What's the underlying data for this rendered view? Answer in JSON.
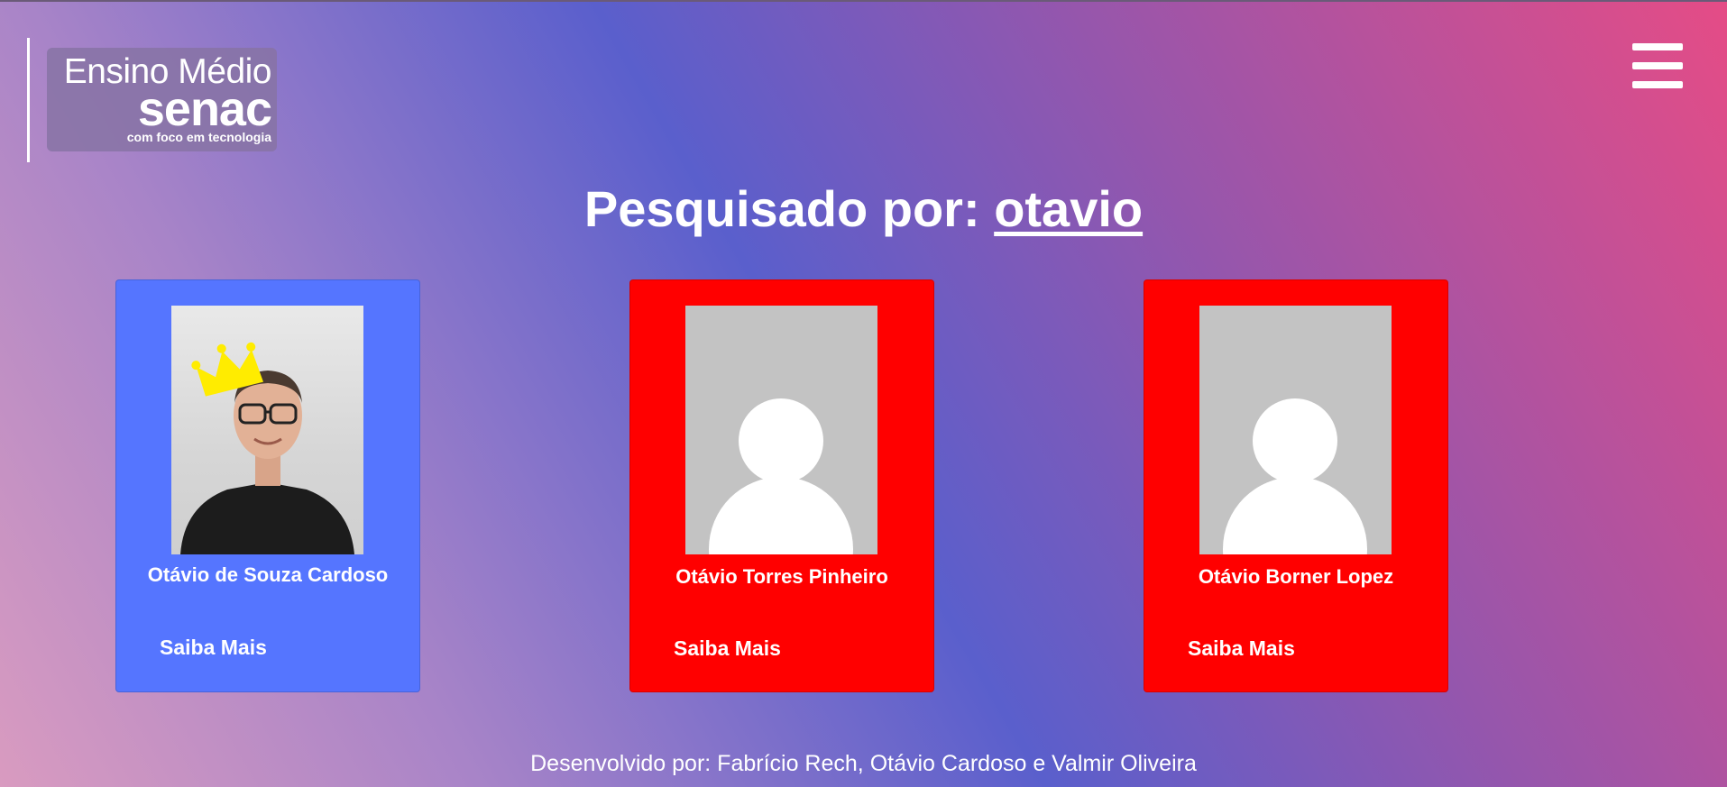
{
  "header": {
    "logo": {
      "line1": "Ensino Médio",
      "line2": "senac",
      "line3": "com foco em tecnologia"
    },
    "menu_icon": "hamburger-menu-icon"
  },
  "search": {
    "prefix": "Pesquisado por: ",
    "term": "otavio"
  },
  "cards": [
    {
      "name": "Otávio de Souza Cardoso",
      "link": "Saiba Mais",
      "photo": "student-photo-with-crown",
      "color": "#5575ff"
    },
    {
      "name": "Otávio Torres Pinheiro",
      "link": "Saiba Mais",
      "photo": "default-avatar-icon",
      "color": "#ff0000"
    },
    {
      "name": "Otávio Borner Lopez",
      "link": "Saiba Mais",
      "photo": "default-avatar-icon",
      "color": "#ff0000"
    }
  ],
  "footer": {
    "credits": "Desenvolvido por: Fabrício Rech, Otávio Cardoso e Valmir Oliveira"
  },
  "colors": {
    "highlight_card": "#5575ff",
    "card": "#ff0000",
    "text": "#ffffff"
  }
}
